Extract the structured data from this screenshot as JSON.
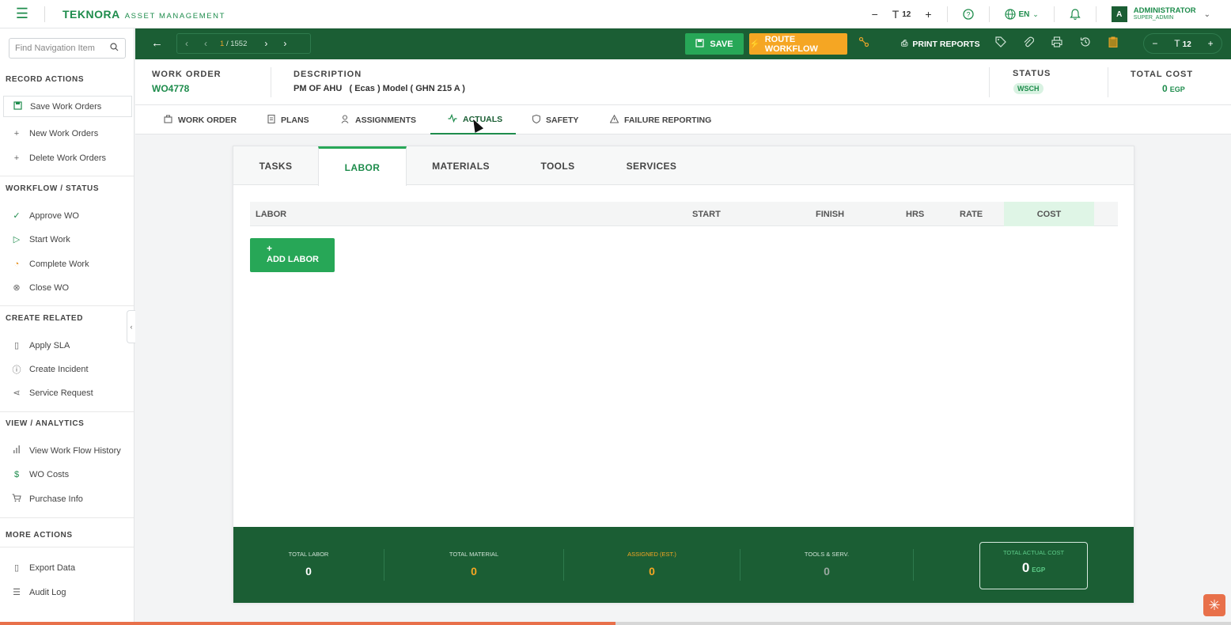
{
  "topbar": {
    "brand": "TEKNORA",
    "brand_sub": "ASSET MANAGEMENT",
    "font_size": "12",
    "language": "EN",
    "user_initial": "A",
    "user_name": "ADMINISTRATOR",
    "user_role": "SUPER_ADMIN"
  },
  "sidebar": {
    "search_placeholder": "Find Navigation Item",
    "sections": {
      "record_actions": "RECORD ACTIONS",
      "workflow": "WORKFLOW / STATUS",
      "create_related": "CREATE RELATED",
      "view_analytics": "VIEW / ANALYTICS",
      "more_actions": "MORE ACTIONS"
    },
    "items": {
      "save": "Save Work Orders",
      "new": "New Work Orders",
      "delete": "Delete Work Orders",
      "approve": "Approve WO",
      "start": "Start Work",
      "complete": "Complete Work",
      "close": "Close WO",
      "apply_sla": "Apply SLA",
      "create_incident": "Create Incident",
      "service_request": "Service Request",
      "workflow_history": "View Work Flow History",
      "wo_costs": "WO Costs",
      "purchase_info": "Purchase Info",
      "export": "Export Data",
      "audit": "Audit Log"
    }
  },
  "toolbar": {
    "pager_current": "1",
    "pager_total": "/ 1552",
    "save_label": "SAVE",
    "route_label": "ROUTE WORKFLOW",
    "print_label": "PRINT REPORTS",
    "font_size": "12"
  },
  "header": {
    "wo_label": "WORK ORDER",
    "wo_value": "WO4778",
    "desc_label": "DESCRIPTION",
    "desc_value": "PM OF AHU   ( Ecas ) Model ( GHN 215 A )",
    "status_label": "STATUS",
    "status_value": "WSCH",
    "cost_label": "TOTAL COST",
    "cost_value": "0",
    "cost_currency": "EGP"
  },
  "main_tabs": {
    "work_order": "WORK ORDER",
    "plans": "PLANS",
    "assignments": "ASSIGNMENTS",
    "actuals": "ACTUALS",
    "safety": "SAFETY",
    "failure": "FAILURE REPORTING"
  },
  "sub_tabs": {
    "tasks": "TASKS",
    "labor": "LABOR",
    "materials": "MATERIALS",
    "tools": "TOOLS",
    "services": "SERVICES"
  },
  "labor_table": {
    "columns": [
      "LABOR",
      "START",
      "FINISH",
      "HRS",
      "RATE",
      "COST"
    ],
    "add_label": "ADD LABOR",
    "add_plus": "+"
  },
  "footer": {
    "total_labor_label": "TOTAL LABOR",
    "total_labor": "0",
    "total_material_label": "TOTAL MATERIAL",
    "total_material": "0",
    "assigned_label": "ASSIGNED (EST.)",
    "assigned": "0",
    "tools_label": "TOOLS & SERV.",
    "tools": "0",
    "total_actual_label": "TOTAL ACTUAL COST",
    "total_actual": "0",
    "total_actual_currency": "EGP"
  },
  "colors": {
    "primary_dark": "#1b5e34",
    "primary": "#27a757",
    "accent_orange": "#f5a623"
  },
  "progress_fraction": 0.5
}
